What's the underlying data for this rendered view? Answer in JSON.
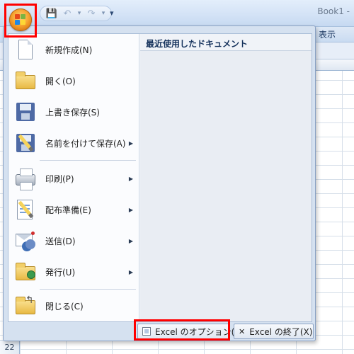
{
  "window": {
    "title": "Book1 -"
  },
  "ribbon": {
    "visible_tab": "表示"
  },
  "quick_access": {
    "save_icon": "save-icon",
    "undo_icon": "undo-icon",
    "redo_icon": "redo-icon",
    "more": "▾"
  },
  "sheet": {
    "visible_row_number": "22"
  },
  "office_menu": {
    "items": [
      {
        "label": "新規作成(N)",
        "icon": "new-document-icon",
        "has_submenu": false
      },
      {
        "label": "開く(O)",
        "icon": "open-folder-icon",
        "has_submenu": false
      },
      {
        "label": "上書き保存(S)",
        "icon": "save-disk-icon",
        "has_submenu": false
      },
      {
        "label": "名前を付けて保存(A)",
        "icon": "save-as-icon",
        "has_submenu": true
      },
      {
        "label": "印刷(P)",
        "icon": "printer-icon",
        "has_submenu": true
      },
      {
        "label": "配布準備(E)",
        "icon": "prepare-icon",
        "has_submenu": true
      },
      {
        "label": "送信(D)",
        "icon": "send-icon",
        "has_submenu": true
      },
      {
        "label": "発行(U)",
        "icon": "publish-icon",
        "has_submenu": true
      },
      {
        "label": "閉じる(C)",
        "icon": "close-folder-icon",
        "has_submenu": false
      }
    ],
    "recent_documents_title": "最近使用したドキュメント",
    "options_button": "Excel のオプション(I)",
    "exit_button": "Excel の終了(X)"
  },
  "highlight_color": "#ff0000"
}
